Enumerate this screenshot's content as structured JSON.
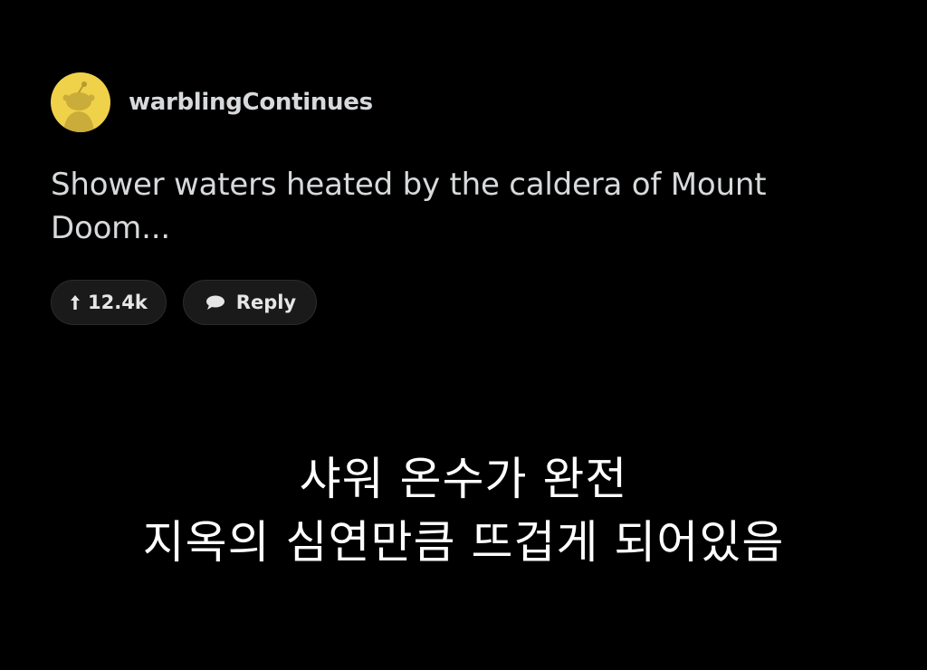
{
  "comment": {
    "author": "warblingContinues",
    "avatar_icon": "snoo-avatar-icon",
    "avatar_color": "#f0d24a",
    "body": "Shower waters heated by the caldera of Mount Doom..."
  },
  "actions": {
    "upvote_icon": "arrow-up-icon",
    "upvote_count": "12.4k",
    "reply_icon": "speech-bubble-icon",
    "reply_label": "Reply"
  },
  "caption": {
    "line1": "샤워 온수가 완전",
    "line2": "지옥의 심연만큼 뜨겁게 되어있음"
  }
}
